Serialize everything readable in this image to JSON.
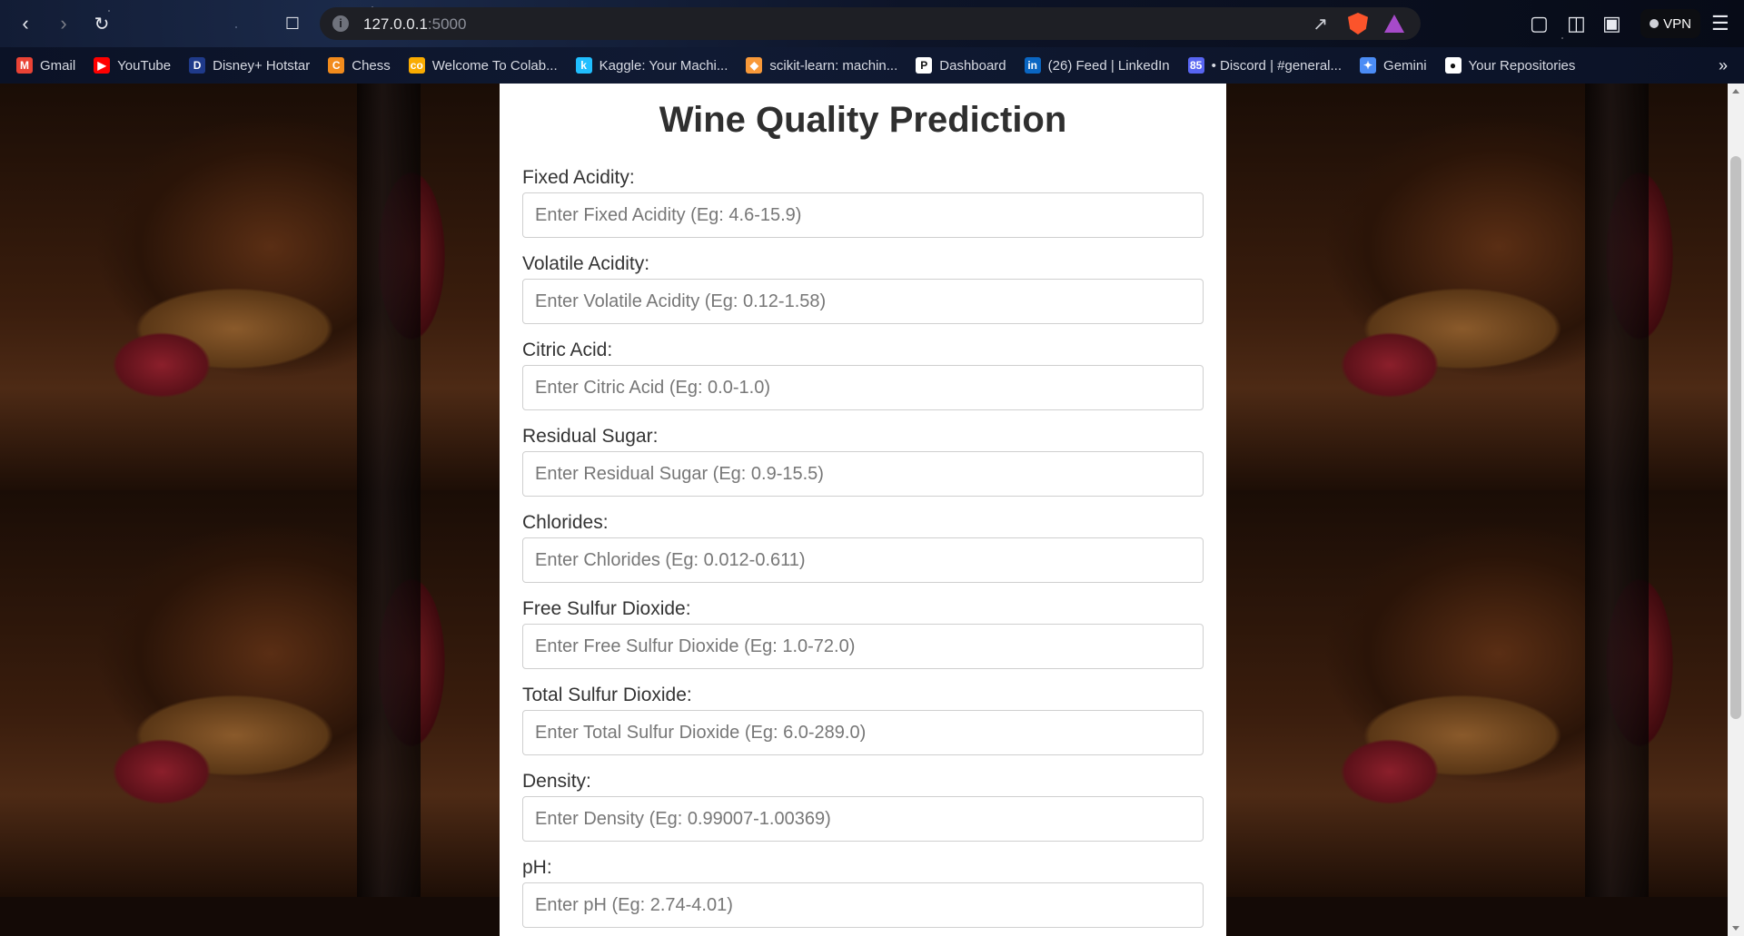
{
  "browser": {
    "url_host": "127.0.0.1",
    "url_port": ":5000",
    "vpn_label": "VPN",
    "bookmarks": [
      {
        "label": "Gmail",
        "icon": "gmail-icon",
        "color": "#ea4335",
        "glyph": "M"
      },
      {
        "label": "YouTube",
        "icon": "youtube-icon",
        "color": "#ff0000",
        "glyph": "▶"
      },
      {
        "label": "Disney+ Hotstar",
        "icon": "hotstar-icon",
        "color": "#1f3a8a",
        "glyph": "D"
      },
      {
        "label": "Chess",
        "icon": "chess-icon",
        "color": "#f28b1c",
        "glyph": "C"
      },
      {
        "label": "Welcome To Colab...",
        "icon": "colab-icon",
        "color": "#f9ab00",
        "glyph": "co"
      },
      {
        "label": "Kaggle: Your Machi...",
        "icon": "kaggle-icon",
        "color": "#20beff",
        "glyph": "k"
      },
      {
        "label": "scikit-learn: machin...",
        "icon": "scikit-learn-icon",
        "color": "#f89939",
        "glyph": "◆"
      },
      {
        "label": "Dashboard",
        "icon": "dashboard-icon",
        "color": "#ffffff",
        "glyph": "P"
      },
      {
        "label": "(26) Feed | LinkedIn",
        "icon": "linkedin-icon",
        "color": "#0a66c2",
        "glyph": "in"
      },
      {
        "label": "• Discord | #general...",
        "icon": "discord-icon",
        "color": "#5865f2",
        "glyph": "85"
      },
      {
        "label": "Gemini",
        "icon": "gemini-icon",
        "color": "#4b8cf5",
        "glyph": "✦"
      },
      {
        "label": "Your Repositories",
        "icon": "github-icon",
        "color": "#ffffff",
        "glyph": "●"
      }
    ]
  },
  "page": {
    "title": "Wine Quality Prediction",
    "fields": [
      {
        "label": "Fixed Acidity:",
        "placeholder": "Enter Fixed Acidity (Eg: 4.6-15.9)"
      },
      {
        "label": "Volatile Acidity:",
        "placeholder": "Enter Volatile Acidity (Eg: 0.12-1.58)"
      },
      {
        "label": "Citric Acid:",
        "placeholder": "Enter Citric Acid (Eg: 0.0-1.0)"
      },
      {
        "label": "Residual Sugar:",
        "placeholder": "Enter Residual Sugar (Eg: 0.9-15.5)"
      },
      {
        "label": "Chlorides:",
        "placeholder": "Enter Chlorides (Eg: 0.012-0.611)"
      },
      {
        "label": "Free Sulfur Dioxide:",
        "placeholder": "Enter Free Sulfur Dioxide (Eg: 1.0-72.0)"
      },
      {
        "label": "Total Sulfur Dioxide:",
        "placeholder": "Enter Total Sulfur Dioxide (Eg: 6.0-289.0)"
      },
      {
        "label": "Density:",
        "placeholder": "Enter Density (Eg: 0.99007-1.00369)"
      },
      {
        "label": "pH:",
        "placeholder": "Enter pH (Eg: 2.74-4.01)"
      }
    ]
  }
}
